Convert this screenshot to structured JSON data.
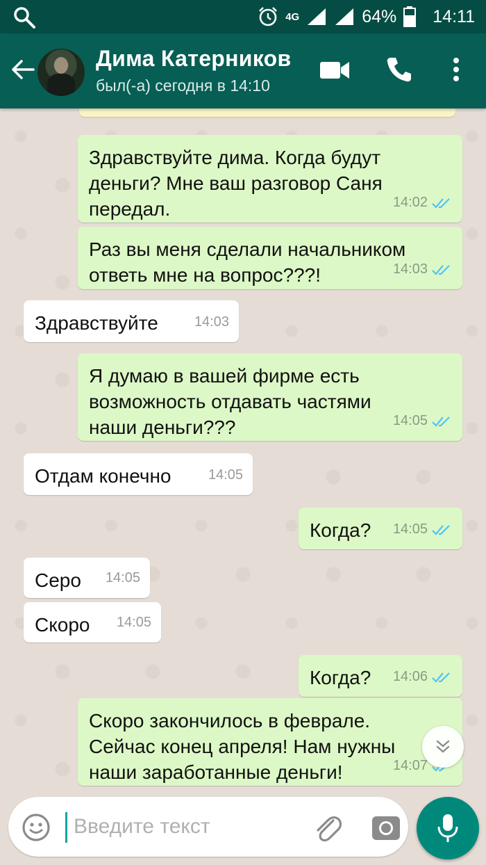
{
  "status_bar": {
    "network": "4G",
    "battery": "64%",
    "time": "14:11"
  },
  "header": {
    "contact_name": "Дима Катерников",
    "last_seen": "был(-а) сегодня в 14:10"
  },
  "messages": [
    {
      "direction": "out",
      "lines": [
        "Здравствуйте дима. Когда будут",
        "деньги? Мне ваш разговор Саня",
        "передал."
      ],
      "time": "14:02",
      "status": "read"
    },
    {
      "direction": "out",
      "lines": [
        "Раз вы меня сделали начальником",
        "ответь мне на вопрос???!"
      ],
      "time": "14:03",
      "status": "read"
    },
    {
      "direction": "in",
      "lines": [
        "Здравствуйте"
      ],
      "time": "14:03"
    },
    {
      "direction": "out",
      "lines": [
        "Я думаю в вашей фирме есть",
        "возможность отдавать частями",
        "наши деньги???"
      ],
      "time": "14:05",
      "status": "read"
    },
    {
      "direction": "in",
      "lines": [
        "Отдам конечно"
      ],
      "time": "14:05"
    },
    {
      "direction": "out",
      "lines": [
        "Когда?"
      ],
      "time": "14:05",
      "status": "read"
    },
    {
      "direction": "in",
      "lines": [
        "Серо"
      ],
      "time": "14:05"
    },
    {
      "direction": "in",
      "lines": [
        "Скоро"
      ],
      "time": "14:05"
    },
    {
      "direction": "out",
      "lines": [
        "Когда?"
      ],
      "time": "14:06",
      "status": "read"
    },
    {
      "direction": "out",
      "lines": [
        "Скоро закончилось в феврале.",
        "Сейчас конец апреля! Нам нужны",
        "наши заработанные деньги!"
      ],
      "time": "14:07",
      "status": "read"
    }
  ],
  "composer": {
    "placeholder": "Введите текст"
  },
  "colors": {
    "header": "#075e54",
    "status_bar": "#054d44",
    "outgoing_bubble": "#dcf8c6",
    "incoming_bubble": "#ffffff",
    "read_ticks": "#4fc3f7",
    "mic_button": "#00897b"
  },
  "icons": [
    "search-icon",
    "alarm-icon",
    "signal-icon",
    "battery-icon",
    "back-arrow-icon",
    "video-call-icon",
    "phone-icon",
    "more-vert-icon",
    "double-check-icon",
    "chevron-down-icon",
    "emoji-icon",
    "attach-icon",
    "camera-icon",
    "mic-icon"
  ]
}
